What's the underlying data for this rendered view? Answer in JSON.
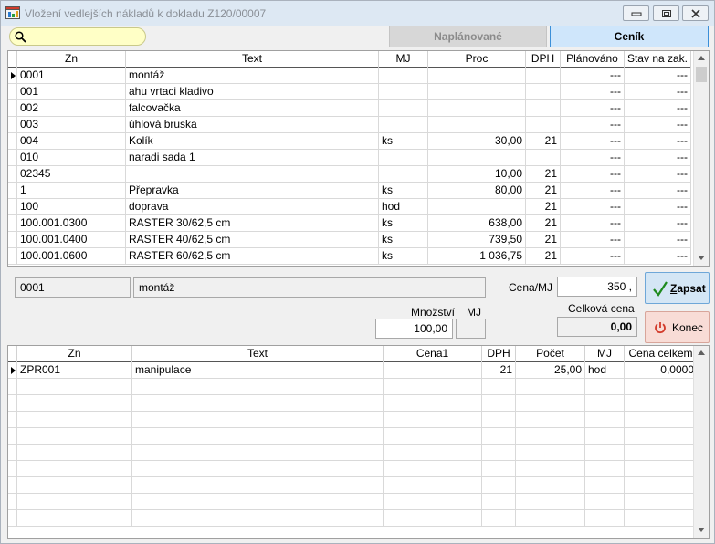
{
  "window": {
    "title": "Vložení vedlejších nákladů k dokladu Z120/00007"
  },
  "search": {
    "placeholder": ""
  },
  "tabs": {
    "planned": "Naplánované",
    "pricelist": "Ceník"
  },
  "grid1": {
    "columns": [
      "Zn",
      "Text",
      "MJ",
      "Proc",
      "DPH",
      "Plánováno",
      "Stav na zak."
    ],
    "rows": [
      [
        "0001",
        "montáž",
        "",
        "",
        "",
        "---",
        "---"
      ],
      [
        "001",
        "ahu vrtaci kladivo",
        "",
        "",
        "",
        "---",
        "---"
      ],
      [
        "002",
        "falcovačka",
        "",
        "",
        "",
        "---",
        "---"
      ],
      [
        "003",
        "úhlová bruska",
        "",
        "",
        "",
        "---",
        "---"
      ],
      [
        "004",
        "Kolík",
        "ks",
        "30,00",
        "21",
        "---",
        "---"
      ],
      [
        "010",
        "naradi sada 1",
        "",
        "",
        "",
        "---",
        "---"
      ],
      [
        "02345",
        "",
        "",
        "10,00",
        "21",
        "---",
        "---"
      ],
      [
        "1",
        "Přepravka",
        "ks",
        "80,00",
        "21",
        "---",
        "---"
      ],
      [
        "100",
        "doprava",
        "hod",
        "",
        "21",
        "---",
        "---"
      ],
      [
        "100.001.0300",
        "RASTER  30/62,5 cm",
        "ks",
        "638,00",
        "21",
        "---",
        "---"
      ],
      [
        "100.001.0400",
        "RASTER  40/62,5 cm",
        "ks",
        "739,50",
        "21",
        "---",
        "---"
      ],
      [
        "100.001.0600",
        "RASTER  60/62,5 cm",
        "ks",
        "1 036,75",
        "21",
        "---",
        "---"
      ]
    ]
  },
  "detail": {
    "code": "0001",
    "text": "montáž",
    "price_label": "Cena/MJ",
    "price_value": "350  ,",
    "total_label": "Celková cena",
    "total_value": "0,00",
    "qty_label": "Množství",
    "unit_label": "MJ",
    "qty_value": "100,00",
    "unit_value": ""
  },
  "buttons": {
    "save": "Zapsat",
    "end": "Konec"
  },
  "grid2": {
    "columns": [
      "Zn",
      "Text",
      "Cena1",
      "DPH",
      "Počet",
      "MJ",
      "Cena celkem"
    ],
    "rows": [
      [
        "ZPR001",
        "manipulace",
        "",
        "21",
        "25,00",
        "hod",
        "0,0000"
      ]
    ]
  },
  "colors": {
    "save_check": "#1e8a1e",
    "end_power": "#d23a2a",
    "tab_active_border": "#3b8fd8"
  }
}
